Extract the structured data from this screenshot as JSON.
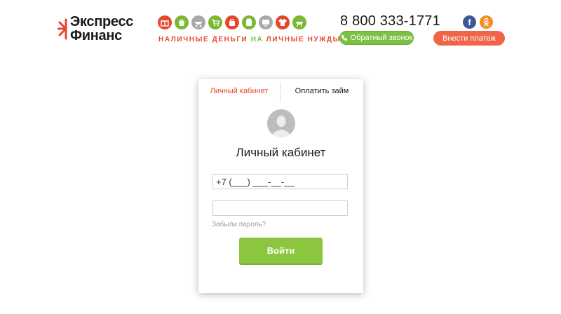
{
  "header": {
    "logo": {
      "line1": "Экспресс",
      "line2": "Финанс"
    },
    "category_icons": [
      "gift-icon",
      "shopping-bag-icon",
      "pram-icon",
      "cart-icon",
      "bag-icon",
      "pills-icon",
      "tv-icon",
      "shirt-icon",
      "grill-icon"
    ],
    "slogan": {
      "part1": "НАЛИЧНЫЕ ДЕНЬГИ ",
      "part2": "НА",
      "part3": " ЛИЧНЫЕ НУЖДЫ"
    },
    "phone": "8 800 333-1771",
    "callback_label": "Обратный звонок",
    "pay_label": "Внести платеж",
    "social": {
      "fb_letter": "f"
    }
  },
  "colors": {
    "accent_red": "#e8452c",
    "accent_green": "#7bb834",
    "button_green": "#8cc63f",
    "button_orange": "#f06548",
    "facebook": "#3b5998",
    "odnoklassniki": "#f38b1d"
  },
  "card": {
    "tabs": [
      {
        "label": "Личный кабинет",
        "active": true
      },
      {
        "label": "Оплатить займ",
        "active": false
      }
    ],
    "title": "Личный кабинет",
    "phone_value": "+7 (___) ___-__-__",
    "password_value": "",
    "forgot_label": "Забыли пароль?",
    "login_label": "Войти"
  }
}
